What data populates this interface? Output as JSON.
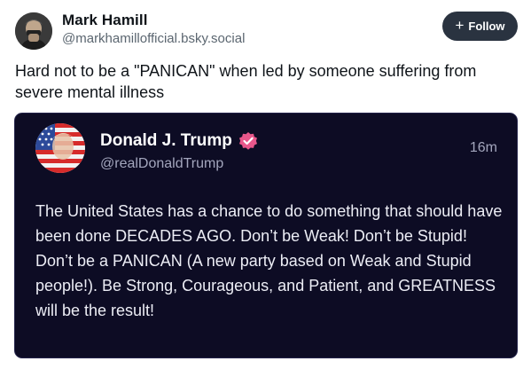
{
  "post": {
    "author_name": "Mark Hamill",
    "author_handle": "@markhamillofficial.bsky.social",
    "follow_label": "Follow",
    "text": "Hard not to be a \"PANICAN\" when led by someone suffering from severe mental illness"
  },
  "quote": {
    "author_name": "Donald J. Trump",
    "author_handle": "@realDonaldTrump",
    "time": "16m",
    "text": "The United States has a chance to do something that should have been done DECADES AGO. Don’t be Weak! Don’t be Stupid! Don’t be a PANICAN (A new party based on Weak and Stupid people!). Be Strong, Courageous, and Patient, and GREATNESS will be the result!"
  },
  "icons": {
    "follow": "plus-icon",
    "verified": "verified-badge-icon"
  },
  "colors": {
    "follow_button_bg": "#2a3340",
    "quote_card_bg": "#0d0c24",
    "verified_badge": "#e8578b"
  }
}
